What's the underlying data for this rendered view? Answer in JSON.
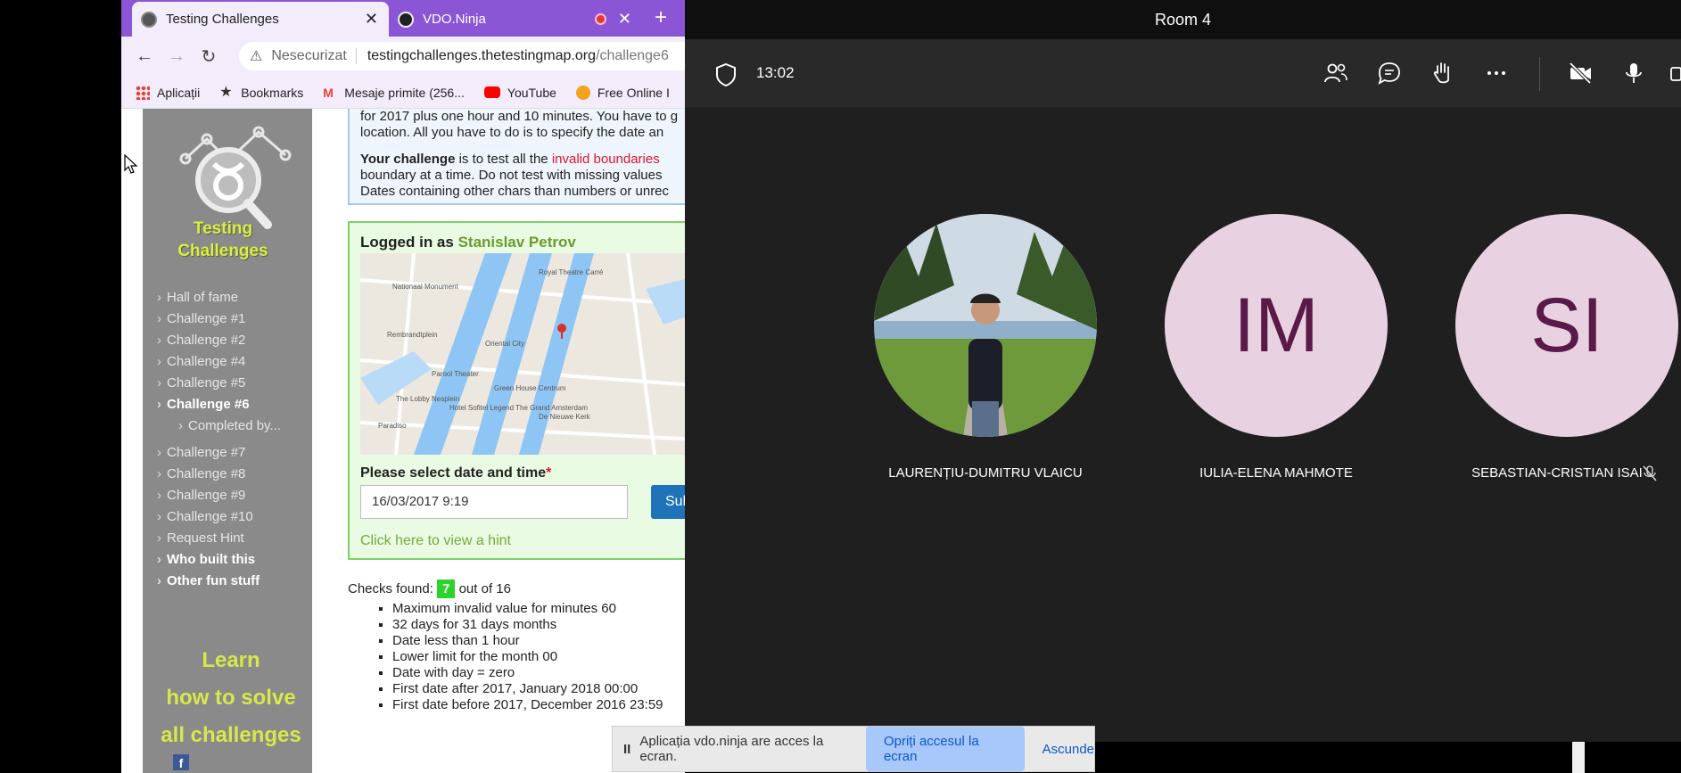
{
  "browser": {
    "tabs": [
      {
        "label": "Testing Challenges",
        "active": true
      },
      {
        "label": "VDO.Ninja",
        "active": false
      }
    ],
    "address": {
      "security_label": "Nesecurizat",
      "url_host": "testingchallenges.thetestingmap.org",
      "url_path": "/challenge6"
    },
    "bookmarks": [
      "Aplicații",
      "Bookmarks",
      "Mesaje primite (256...",
      "YouTube",
      "Free Online I"
    ]
  },
  "page": {
    "logo_line1": "Testing",
    "logo_line2": "Challenges",
    "nav": [
      {
        "label": "Hall of fame",
        "bold": false,
        "sub": false
      },
      {
        "label": "Challenge #1",
        "bold": false,
        "sub": false
      },
      {
        "label": "Challenge #2",
        "bold": false,
        "sub": false
      },
      {
        "label": "Challenge #4",
        "bold": false,
        "sub": false
      },
      {
        "label": "Challenge #5",
        "bold": false,
        "sub": false
      },
      {
        "label": "Challenge #6",
        "bold": true,
        "sub": false
      },
      {
        "label": "Completed by...",
        "bold": false,
        "sub": true
      },
      {
        "label": "Challenge #7",
        "bold": false,
        "sub": false
      },
      {
        "label": "Challenge #8",
        "bold": false,
        "sub": false
      },
      {
        "label": "Challenge #9",
        "bold": false,
        "sub": false
      },
      {
        "label": "Challenge #10",
        "bold": false,
        "sub": false
      },
      {
        "label": "Request Hint",
        "bold": false,
        "sub": false
      },
      {
        "label": "Who built this",
        "bold": true,
        "sub": false
      },
      {
        "label": "Other fun stuff",
        "bold": true,
        "sub": false
      }
    ],
    "learn": [
      "Learn",
      "how to solve",
      "all challenges"
    ],
    "description": {
      "line1": "for 2017 plus one hour and 10 minutes. You have to g",
      "line2": "location. All you have to do is to specify the date an",
      "challenge_prefix": "Your challenge",
      "challenge_mid": " is to test all the ",
      "challenge_red": "invalid boundaries",
      "line4": "boundary at a time. Do not test with missing values",
      "line5": "Dates containing other chars than numbers or unrec"
    },
    "login": {
      "prefix": "Logged in as ",
      "username": "Stanislav Petrov"
    },
    "map_labels": [
      "Nationaal Monument",
      "Royal Theatre Carré",
      "Oriental City",
      "Rembrandtplein",
      "Paradiso",
      "Parool Theater",
      "Hotel Sofitel Legend The Grand Amsterdam",
      "De Nieuwe Kerk",
      "The Lobby Nesplein",
      "Green House Centrum"
    ],
    "date_label": "Please select date and time",
    "date_required_mark": "*",
    "date_value": "16/03/2017 9:19",
    "submit_label": "Submit",
    "hint_link": "Click here to view a hint",
    "checks_prefix": "Checks found:",
    "checks_count": "7",
    "checks_suffix": "out of 16",
    "checks_list": [
      "Maximum invalid value for minutes 60",
      "32 days for 31 days months",
      "Date less than 1 hour",
      "Lower limit for the month 00",
      "Date with day = zero",
      "First date after 2017, January 2018 00:00",
      "First date before 2017, December 2016 23:59"
    ]
  },
  "meeting": {
    "room_title": "Room 4",
    "timer": "13:02",
    "participants": [
      {
        "name": "LAURENȚIU-DUMITRU VLAICU",
        "initials": "",
        "has_photo": true
      },
      {
        "name": "IULIA-ELENA MAHMOTE",
        "initials": "IM",
        "has_photo": false
      },
      {
        "name": "SEBASTIAN-CRISTIAN ISAI",
        "initials": "SI",
        "has_photo": false
      }
    ],
    "colors": {
      "avatar_bg": "#e8d2e2",
      "avatar_fg": "#5a1947",
      "bg": "#1f1f1f",
      "toolbar": "#292929"
    }
  },
  "sharebar": {
    "message": "Aplicația vdo.ninja are acces la ecran.",
    "stop_label": "Opriți accesul la ecran",
    "hide_label": "Ascunde"
  }
}
